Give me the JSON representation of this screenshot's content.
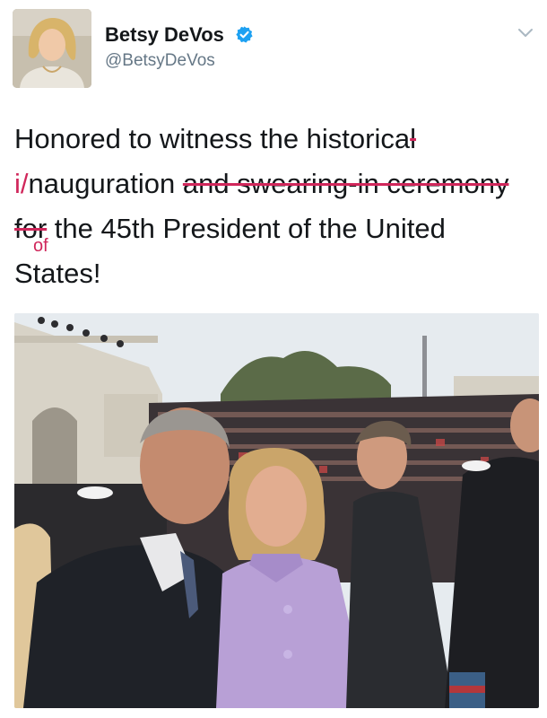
{
  "author": {
    "name": "Betsy DeVos",
    "handle": "@BetsyDeVos",
    "verified": true,
    "avatar_icon": "profile-photo-icon"
  },
  "menu": {
    "icon": "chevron-down-icon"
  },
  "tweet": {
    "line1_a": "Honored to witness the historica",
    "line1_struck": "l",
    "line2_mark": "i/",
    "line2_a": "nauguration ",
    "line2_struck": "and swearing-in ceremony",
    "line3_struck": "for",
    "line3_insert": "of",
    "line3_a": " the 45th President of the United",
    "line4": "States!"
  },
  "colors": {
    "accent_red": "#d0275b",
    "verified_blue": "#1da1f2",
    "handle_gray": "#657786"
  },
  "media": {
    "type": "photo",
    "icon": "inauguration-photo"
  }
}
